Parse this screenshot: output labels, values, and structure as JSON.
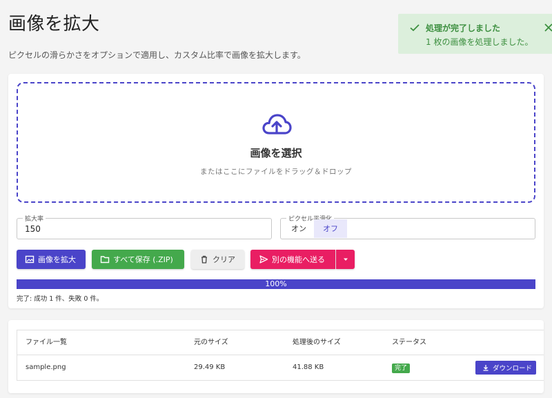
{
  "page": {
    "title": "画像を拡大",
    "description": "ピクセルの滑らかさをオプションで適用し、カスタム比率で画像を拡大します。"
  },
  "toast": {
    "title": "処理が完了しました",
    "message": "1 枚の画像を処理しました。",
    "color": "#3c8f3f"
  },
  "dropzone": {
    "icon": "cloud-upload-icon",
    "title": "画像を選択",
    "subtitle": "またはここにファイルをドラッグ＆ドロップ"
  },
  "options": {
    "scale_label": "拡大率",
    "scale_value": "150",
    "smoothing_label": "ピクセル平滑化",
    "smoothing_on": "オン",
    "smoothing_off": "オフ",
    "smoothing_selected": "オフ"
  },
  "buttons": {
    "enlarge": "画像を拡大",
    "save_all": "すべて保存 (.ZIP)",
    "clear": "クリア",
    "send": "別の機能へ送る"
  },
  "progress": {
    "value": 100,
    "label": "100%",
    "status": "完了: 成功 1 件、失敗 0 件。"
  },
  "table": {
    "headers": [
      "ファイル一覧",
      "元のサイズ",
      "処理後のサイズ",
      "ステータス"
    ],
    "rows": [
      {
        "file": "sample.png",
        "original_size": "29.49 KB",
        "processed_size": "41.88 KB",
        "status": "完了",
        "action": "ダウンロード"
      }
    ]
  },
  "colors": {
    "accent": "#4a44c9",
    "success": "#44a94c",
    "pink": "#e91e63"
  }
}
